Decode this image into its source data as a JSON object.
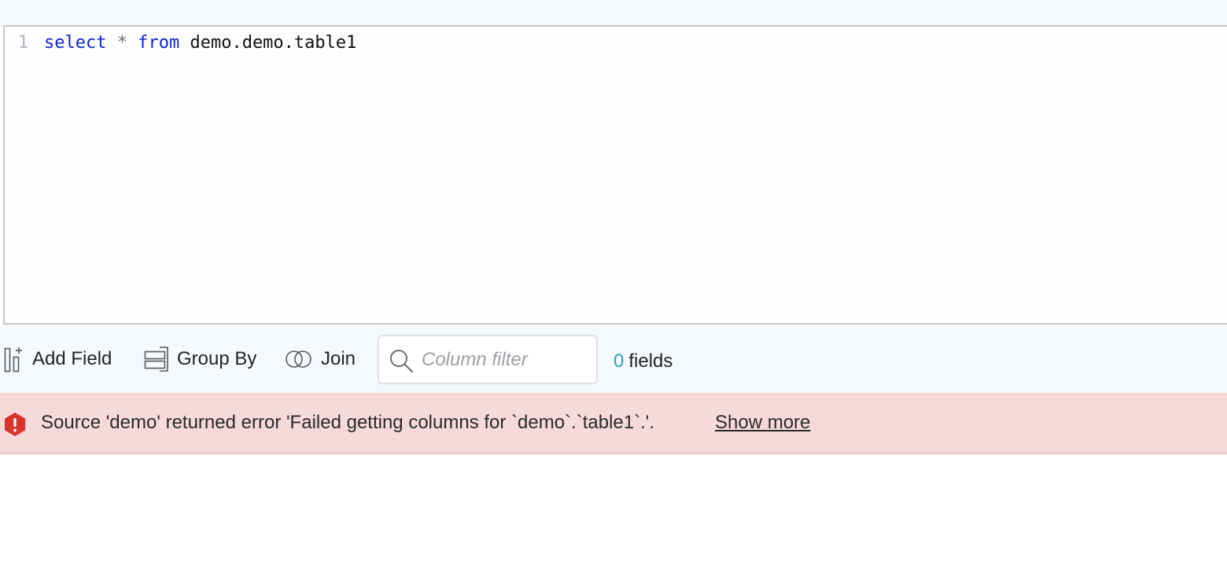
{
  "editor": {
    "line_number": "1",
    "tokens": {
      "kw_select": "select",
      "op_star": "*",
      "kw_from": "from",
      "table_ref": "demo.demo.table1"
    }
  },
  "toolbar": {
    "add_field_label": "Add Field",
    "group_by_label": "Group By",
    "join_label": "Join",
    "column_filter_placeholder": "Column filter",
    "fields_count": "0",
    "fields_label": "fields"
  },
  "error": {
    "message": "Source 'demo' returned error 'Failed getting columns for `demo`.`table1`.'.",
    "show_more_label": "Show more"
  },
  "colors": {
    "keyword": "#0a25d6",
    "count_accent": "#2f9fbf",
    "error_bg": "#f6d9d9",
    "error_icon": "#d9342b"
  },
  "icons": [
    "add-field-icon",
    "group-by-icon",
    "join-icon",
    "search-icon",
    "error-icon"
  ]
}
